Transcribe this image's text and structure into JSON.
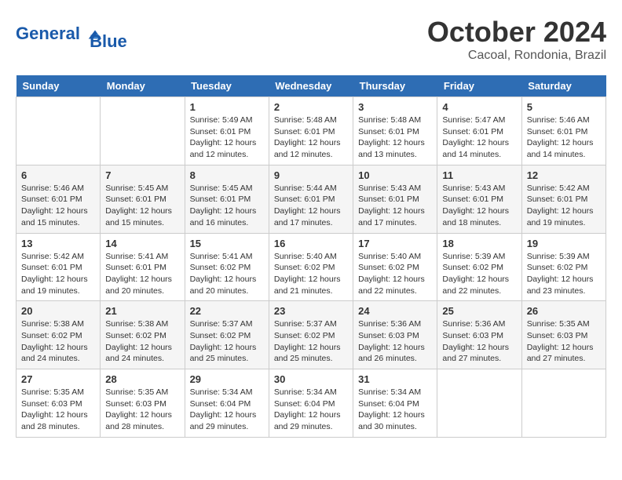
{
  "header": {
    "logo_line1": "General",
    "logo_line2": "Blue",
    "month": "October 2024",
    "location": "Cacoal, Rondonia, Brazil"
  },
  "weekdays": [
    "Sunday",
    "Monday",
    "Tuesday",
    "Wednesday",
    "Thursday",
    "Friday",
    "Saturday"
  ],
  "weeks": [
    [
      {
        "day": "",
        "info": ""
      },
      {
        "day": "",
        "info": ""
      },
      {
        "day": "1",
        "info": "Sunrise: 5:49 AM\nSunset: 6:01 PM\nDaylight: 12 hours and 12 minutes."
      },
      {
        "day": "2",
        "info": "Sunrise: 5:48 AM\nSunset: 6:01 PM\nDaylight: 12 hours and 12 minutes."
      },
      {
        "day": "3",
        "info": "Sunrise: 5:48 AM\nSunset: 6:01 PM\nDaylight: 12 hours and 13 minutes."
      },
      {
        "day": "4",
        "info": "Sunrise: 5:47 AM\nSunset: 6:01 PM\nDaylight: 12 hours and 14 minutes."
      },
      {
        "day": "5",
        "info": "Sunrise: 5:46 AM\nSunset: 6:01 PM\nDaylight: 12 hours and 14 minutes."
      }
    ],
    [
      {
        "day": "6",
        "info": "Sunrise: 5:46 AM\nSunset: 6:01 PM\nDaylight: 12 hours and 15 minutes."
      },
      {
        "day": "7",
        "info": "Sunrise: 5:45 AM\nSunset: 6:01 PM\nDaylight: 12 hours and 15 minutes."
      },
      {
        "day": "8",
        "info": "Sunrise: 5:45 AM\nSunset: 6:01 PM\nDaylight: 12 hours and 16 minutes."
      },
      {
        "day": "9",
        "info": "Sunrise: 5:44 AM\nSunset: 6:01 PM\nDaylight: 12 hours and 17 minutes."
      },
      {
        "day": "10",
        "info": "Sunrise: 5:43 AM\nSunset: 6:01 PM\nDaylight: 12 hours and 17 minutes."
      },
      {
        "day": "11",
        "info": "Sunrise: 5:43 AM\nSunset: 6:01 PM\nDaylight: 12 hours and 18 minutes."
      },
      {
        "day": "12",
        "info": "Sunrise: 5:42 AM\nSunset: 6:01 PM\nDaylight: 12 hours and 19 minutes."
      }
    ],
    [
      {
        "day": "13",
        "info": "Sunrise: 5:42 AM\nSunset: 6:01 PM\nDaylight: 12 hours and 19 minutes."
      },
      {
        "day": "14",
        "info": "Sunrise: 5:41 AM\nSunset: 6:01 PM\nDaylight: 12 hours and 20 minutes."
      },
      {
        "day": "15",
        "info": "Sunrise: 5:41 AM\nSunset: 6:02 PM\nDaylight: 12 hours and 20 minutes."
      },
      {
        "day": "16",
        "info": "Sunrise: 5:40 AM\nSunset: 6:02 PM\nDaylight: 12 hours and 21 minutes."
      },
      {
        "day": "17",
        "info": "Sunrise: 5:40 AM\nSunset: 6:02 PM\nDaylight: 12 hours and 22 minutes."
      },
      {
        "day": "18",
        "info": "Sunrise: 5:39 AM\nSunset: 6:02 PM\nDaylight: 12 hours and 22 minutes."
      },
      {
        "day": "19",
        "info": "Sunrise: 5:39 AM\nSunset: 6:02 PM\nDaylight: 12 hours and 23 minutes."
      }
    ],
    [
      {
        "day": "20",
        "info": "Sunrise: 5:38 AM\nSunset: 6:02 PM\nDaylight: 12 hours and 24 minutes."
      },
      {
        "day": "21",
        "info": "Sunrise: 5:38 AM\nSunset: 6:02 PM\nDaylight: 12 hours and 24 minutes."
      },
      {
        "day": "22",
        "info": "Sunrise: 5:37 AM\nSunset: 6:02 PM\nDaylight: 12 hours and 25 minutes."
      },
      {
        "day": "23",
        "info": "Sunrise: 5:37 AM\nSunset: 6:02 PM\nDaylight: 12 hours and 25 minutes."
      },
      {
        "day": "24",
        "info": "Sunrise: 5:36 AM\nSunset: 6:03 PM\nDaylight: 12 hours and 26 minutes."
      },
      {
        "day": "25",
        "info": "Sunrise: 5:36 AM\nSunset: 6:03 PM\nDaylight: 12 hours and 27 minutes."
      },
      {
        "day": "26",
        "info": "Sunrise: 5:35 AM\nSunset: 6:03 PM\nDaylight: 12 hours and 27 minutes."
      }
    ],
    [
      {
        "day": "27",
        "info": "Sunrise: 5:35 AM\nSunset: 6:03 PM\nDaylight: 12 hours and 28 minutes."
      },
      {
        "day": "28",
        "info": "Sunrise: 5:35 AM\nSunset: 6:03 PM\nDaylight: 12 hours and 28 minutes."
      },
      {
        "day": "29",
        "info": "Sunrise: 5:34 AM\nSunset: 6:04 PM\nDaylight: 12 hours and 29 minutes."
      },
      {
        "day": "30",
        "info": "Sunrise: 5:34 AM\nSunset: 6:04 PM\nDaylight: 12 hours and 29 minutes."
      },
      {
        "day": "31",
        "info": "Sunrise: 5:34 AM\nSunset: 6:04 PM\nDaylight: 12 hours and 30 minutes."
      },
      {
        "day": "",
        "info": ""
      },
      {
        "day": "",
        "info": ""
      }
    ]
  ]
}
